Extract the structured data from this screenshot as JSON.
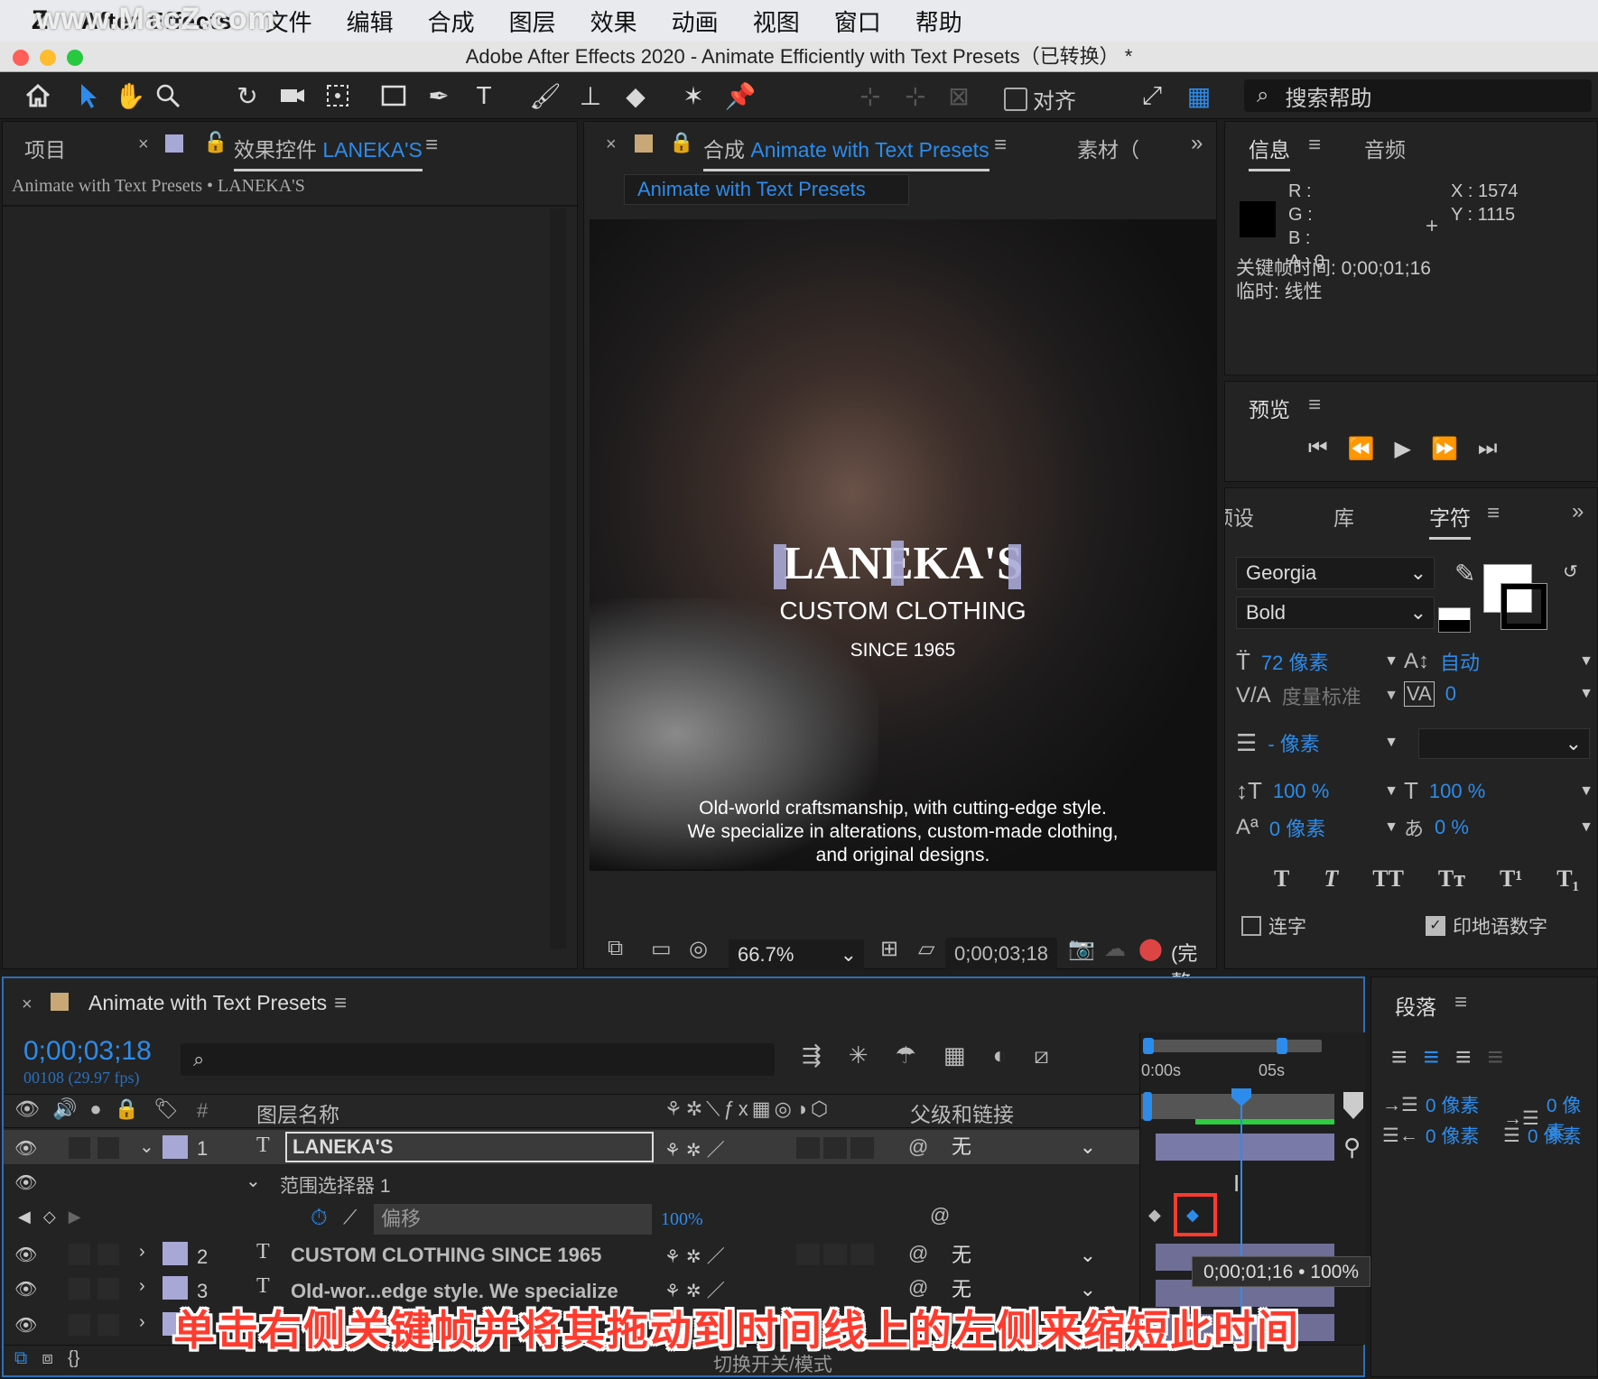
{
  "watermark": "www.MacZ.com",
  "menubar": {
    "app_name": "After Effects",
    "items": [
      "文件",
      "编辑",
      "合成",
      "图层",
      "效果",
      "动画",
      "视图",
      "窗口",
      "帮助"
    ]
  },
  "window": {
    "title": "Adobe After Effects 2020 - Animate Efficiently with Text Presets（已转换） *"
  },
  "toolbar": {
    "align_label": "对齐",
    "search_placeholder": "搜索帮助"
  },
  "left_panel": {
    "tab_project": "项目",
    "tab_effects": "效果控件",
    "tab_effects_layer": "LANEKA'S",
    "breadcrumb": "Animate with Text Presets • LANEKA'S"
  },
  "comp_panel": {
    "tab_prefix": "合成",
    "tab_name": "Animate with Text Presets",
    "tab_material": "素材（",
    "sub_tab": "Animate with Text Presets",
    "canvas": {
      "title": "LANEKA'S",
      "subtitle": "CUSTOM CLOTHING",
      "since": "SINCE 1965",
      "body_lines": [
        "Old-world craftsmanship, with cutting-edge style.",
        "We specialize in alterations, custom-made clothing,",
        "and original designs."
      ]
    },
    "zoom": "66.7%",
    "timecode": "0;00;03;18",
    "quality": "(完整"
  },
  "info_panel": {
    "tab_info": "信息",
    "tab_audio": "音频",
    "r_label": "R :",
    "g_label": "G :",
    "b_label": "B :",
    "a_label": "A :",
    "a_value": "0",
    "x_label": "X :",
    "x_value": "1574",
    "y_label": "Y :",
    "y_value": "1115",
    "keyframe_time": "关键帧时间: 0;00;01;16",
    "temporal": "临时: 线性"
  },
  "preview_panel": {
    "title": "预览"
  },
  "character_panel": {
    "tab_presets": "预设",
    "tab_library": "库",
    "tab_character": "字符",
    "font": "Georgia",
    "style": "Bold",
    "size": "72 像素",
    "leading": "自动",
    "kerning": "度量标准",
    "tracking": "0",
    "stroke": "- 像素",
    "vscale": "100 %",
    "hscale": "100 %",
    "baseline": "0 像素",
    "tsume": "0 %",
    "ligatures": "连字",
    "hindi": "印地语数字",
    "style_buttons": [
      "T",
      "T",
      "TT",
      "Tт",
      "T¹",
      "T₁"
    ]
  },
  "timeline": {
    "tab_name": "Animate with Text Presets",
    "timecode": "0;00;03;18",
    "frames": "00108 (29.97 fps)",
    "col_name": "图层名称",
    "col_num": "#",
    "col_parent": "父级和链接",
    "ruler": [
      "0:00s",
      "05s"
    ],
    "layers": [
      {
        "num": "1",
        "name": "LANEKA'S",
        "parent": "无"
      },
      {
        "num": "2",
        "name": "CUSTOM CLOTHING  SINCE 1965",
        "parent": "无"
      },
      {
        "num": "3",
        "name": "Old-wor...edge style. We specialize",
        "parent": "无"
      }
    ],
    "range_selector": "范围选择器 1",
    "offset_label": "偏移",
    "offset_value": "100%",
    "tooltip": "0;00;01;16 • 100%",
    "bottom_label": "切换开关/模式"
  },
  "paragraph_panel": {
    "title": "段落",
    "indent1": "0 像素",
    "indent2": "0 像素",
    "indent3": "0 像素",
    "indent4": "0 像素"
  },
  "caption": "单击右侧关键帧并将其拖动到时间线上的左侧来缩短此时间"
}
